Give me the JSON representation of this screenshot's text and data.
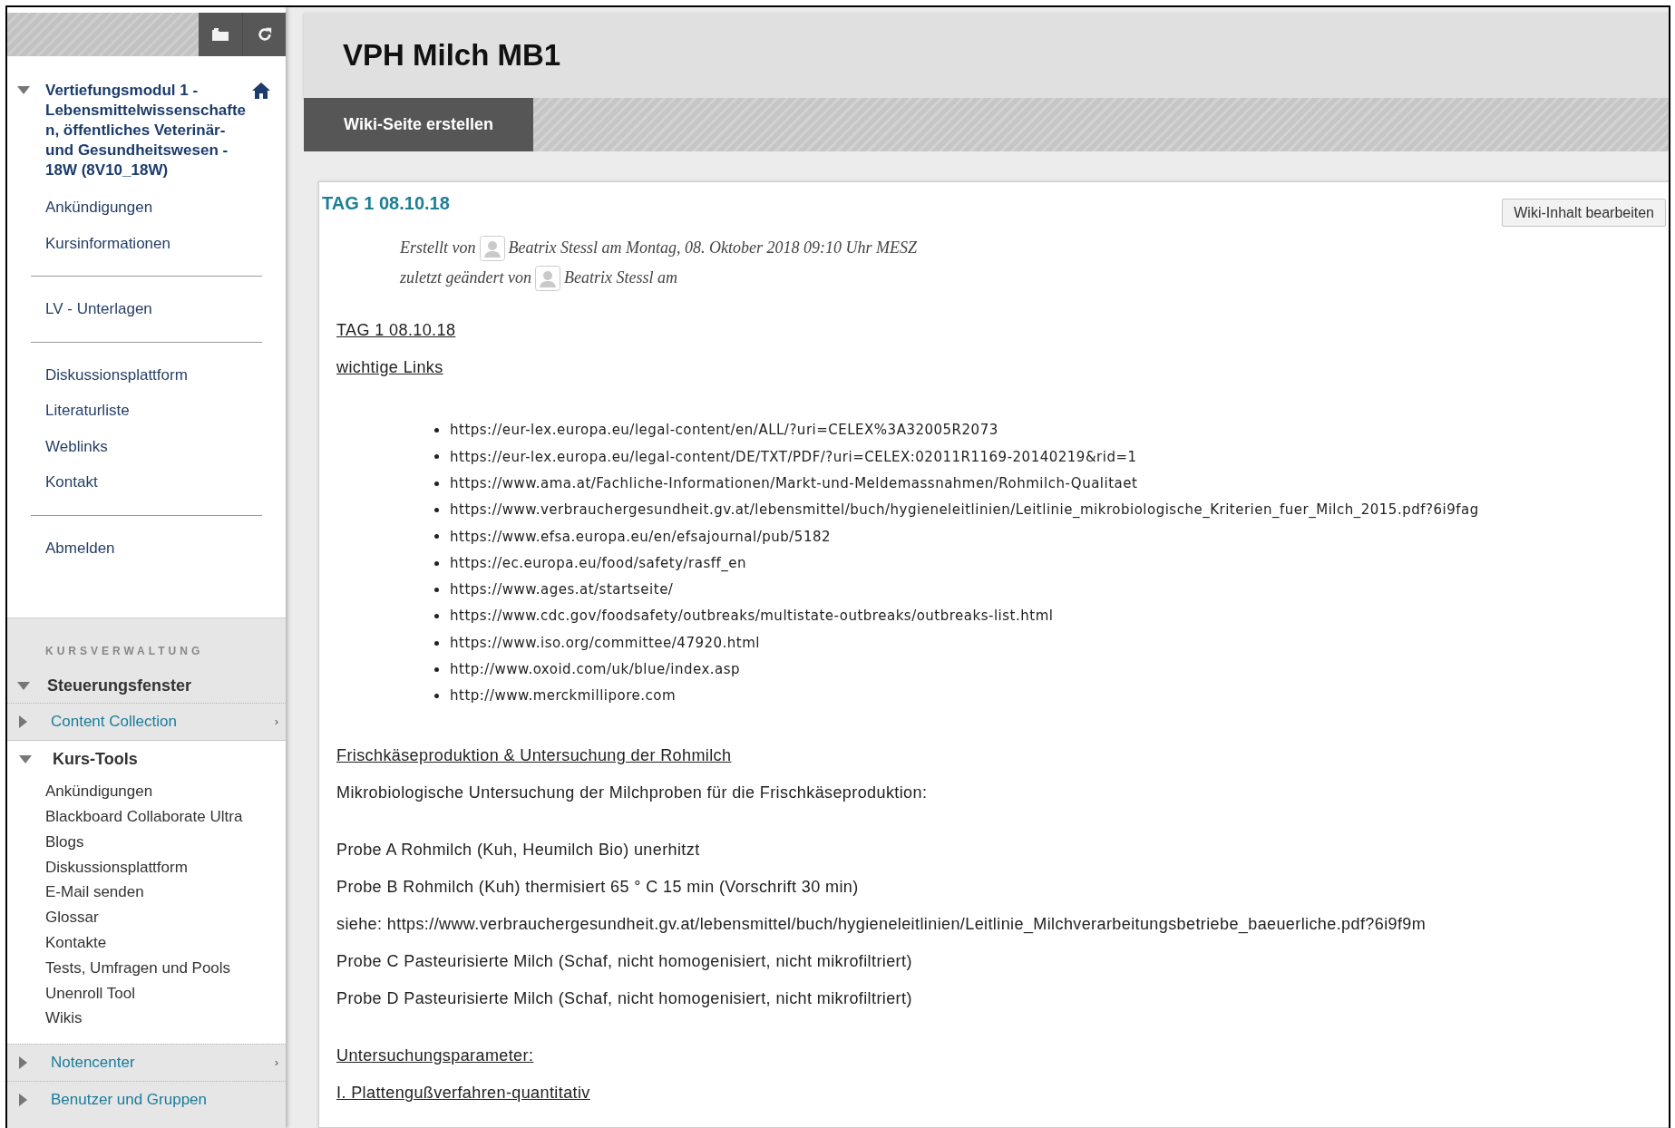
{
  "sidebar": {
    "course": {
      "title": "Vertiefungsmodul 1 - Lebensmittelwissenschaften, öffentliches Veterinär- und Gesundheitswesen - 18W (8V10_18W)",
      "expanded": true
    },
    "menu_groups": [
      {
        "items": [
          "Ankündigungen",
          "Kursinformationen"
        ]
      },
      {
        "items": [
          "LV - Unterlagen"
        ]
      },
      {
        "items": [
          "Diskussionsplattform",
          "Literaturliste",
          "Weblinks",
          "Kontakt"
        ]
      },
      {
        "items": [
          "Abmelden"
        ]
      }
    ],
    "admin": {
      "heading": "KURSVERWALTUNG",
      "title": "Steuerungsfenster",
      "expanded": true,
      "sections": [
        {
          "title": "Content Collection",
          "expanded": false,
          "chevron": "›"
        },
        {
          "title": "Kurs-Tools",
          "expanded": true,
          "items": [
            "Ankündigungen",
            "Blackboard Collaborate Ultra",
            "Blogs",
            "Diskussionsplattform",
            "E-Mail senden",
            "Glossar",
            "Kontakte",
            "Tests, Umfragen und Pools",
            "Unenroll Tool",
            "Wikis"
          ]
        },
        {
          "title": "Notencenter",
          "expanded": false,
          "chevron": "›"
        },
        {
          "title": "Benutzer und Gruppen",
          "expanded": false
        }
      ]
    }
  },
  "page": {
    "title": "VPH Milch MB1",
    "action": "Wiki-Seite erstellen"
  },
  "wiki": {
    "title": "TAG 1 08.10.18",
    "edit_button": "Wiki-Inhalt bearbeiten",
    "meta": [
      {
        "prefix": "Erstellt von",
        "author": "Beatrix Stessl am Montag, 08. Oktober 2018 09:10 Uhr MESZ"
      },
      {
        "prefix": "zuletzt geändert von",
        "author": "Beatrix Stessl am"
      }
    ],
    "body": [
      {
        "kind": "underlined",
        "text": "TAG 1 08.10.18",
        "spaced": false
      },
      {
        "kind": "underlined",
        "text": "wichtige Links",
        "spaced": false
      },
      {
        "kind": "list",
        "spaced": true,
        "items": [
          "https://eur-lex.europa.eu/legal-content/en/ALL/?uri=CELEX%3A32005R2073",
          "https://eur-lex.europa.eu/legal-content/DE/TXT/PDF/?uri=CELEX:02011R1169-20140219&rid=1",
          "https://www.ama.at/Fachliche-Informationen/Markt-und-Meldemassnahmen/Rohmilch-Qualitaet",
          "https://www.verbrauchergesundheit.gv.at/lebensmittel/buch/hygieneleitlinien/Leitlinie_mikrobiologische_Kriterien_fuer_Milch_2015.pdf?6i9fag",
          "https://www.efsa.europa.eu/en/efsajournal/pub/5182",
          "https://ec.europa.eu/food/safety/rasff_en",
          "https://www.ages.at/startseite/",
          "https://www.cdc.gov/foodsafety/outbreaks/multistate-outbreaks/outbreaks-list.html",
          "https://www.iso.org/committee/47920.html",
          "http://www.oxoid.com/uk/blue/index.asp",
          "http://www.merckmillipore.com"
        ]
      },
      {
        "kind": "underlined",
        "text": "Frischkäseproduktion & Untersuchung der Rohmilch",
        "spaced": true
      },
      {
        "kind": "text",
        "text": "Mikrobiologische Untersuchung der Milchproben für die Frischkäseproduktion:",
        "spaced": false
      },
      {
        "kind": "text",
        "text": "Probe A Rohmilch (Kuh, Heumilch Bio) unerhitzt",
        "spaced": true
      },
      {
        "kind": "text",
        "text": "Probe B Rohmilch (Kuh) thermisiert 65 ° C 15 min (Vorschrift 30 min)",
        "spaced": false
      },
      {
        "kind": "text",
        "text": "siehe: https://www.verbrauchergesundheit.gv.at/lebensmittel/buch/hygieneleitlinien/Leitlinie_Milchverarbeitungsbetriebe_baeuerliche.pdf?6i9f9m",
        "spaced": false
      },
      {
        "kind": "text",
        "text": "Probe C Pasteurisierte Milch (Schaf, nicht homogenisiert, nicht mikrofiltriert)",
        "spaced": false
      },
      {
        "kind": "text",
        "text": "Probe D Pasteurisierte Milch (Schaf, nicht homogenisiert, nicht mikrofiltriert)",
        "spaced": false
      },
      {
        "kind": "underlined",
        "text": "Untersuchungsparameter:",
        "spaced": true
      },
      {
        "kind": "underlined",
        "text": "I. Plattengußverfahren-quantitativ",
        "spaced": false
      }
    ]
  }
}
